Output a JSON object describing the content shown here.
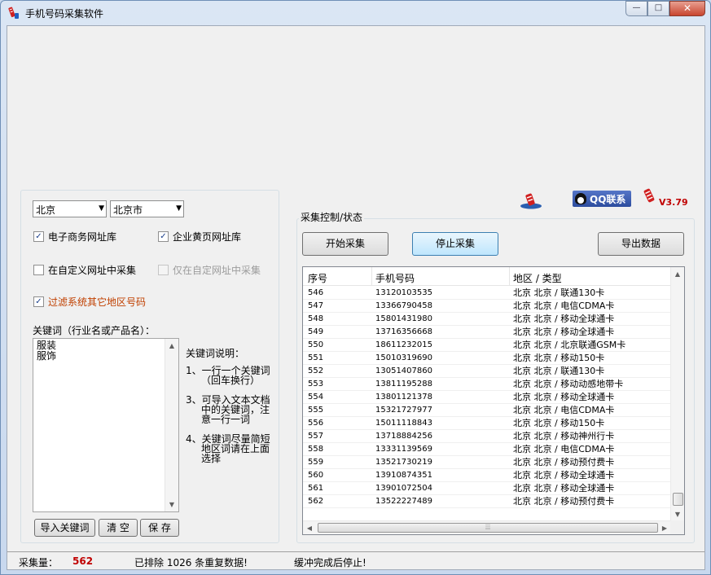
{
  "window": {
    "title": "手机号码采集软件",
    "controls": {
      "minimize": "—",
      "maximize": "□",
      "close": "✕"
    }
  },
  "left": {
    "province": "北京",
    "city": "北京市",
    "checkboxes": {
      "ecommerce": {
        "label": "电子商务网址库",
        "checked": true
      },
      "yellowpages": {
        "label": "企业黄页网址库",
        "checked": true
      },
      "custom": {
        "label": "在自定义网址中采集",
        "checked": false
      },
      "custom_only": {
        "label": "仅在自定网址中采集",
        "checked": false
      },
      "filter": {
        "label": "过滤系统其它地区号码",
        "checked": true
      }
    },
    "keyword_label": "关键词（行业名或产品名）：",
    "keywords": [
      "服装",
      "服饰"
    ],
    "help_title": "关键词说明：",
    "help": [
      [
        "1、一行一个关键词",
        "（回车换行）"
      ],
      [
        "3、可导入文本文档",
        "中的关键词，注",
        "意一行一词"
      ],
      [
        "4、关键词尽量简短",
        "地区词请在上面",
        "选择"
      ]
    ],
    "buttons": {
      "import": "导入关键词",
      "clear": "清 空",
      "save": "保 存"
    }
  },
  "header": {
    "qq": "QQ联系",
    "version": "V3.79"
  },
  "collect": {
    "title": "采集控制/状态",
    "start": "开始采集",
    "stop": "停止采集",
    "export": "导出数据",
    "columns": [
      "序号",
      "手机号码",
      "地区 / 类型"
    ],
    "rows": [
      [
        "546",
        "13120103535",
        "北京 北京 / 联通130卡"
      ],
      [
        "547",
        "13366790458",
        "北京 北京 / 电信CDMA卡"
      ],
      [
        "548",
        "15801431980",
        "北京 北京 / 移动全球通卡"
      ],
      [
        "549",
        "13716356668",
        "北京 北京 / 移动全球通卡"
      ],
      [
        "550",
        "18611232015",
        "北京 北京 / 北京联通GSM卡"
      ],
      [
        "551",
        "15010319690",
        "北京 北京 / 移动150卡"
      ],
      [
        "552",
        "13051407860",
        "北京 北京 / 联通130卡"
      ],
      [
        "553",
        "13811195288",
        "北京 北京 / 移动动感地带卡"
      ],
      [
        "554",
        "13801121378",
        "北京 北京 / 移动全球通卡"
      ],
      [
        "555",
        "15321727977",
        "北京 北京 / 电信CDMA卡"
      ],
      [
        "556",
        "15011118843",
        "北京 北京 / 移动150卡"
      ],
      [
        "557",
        "13718884256",
        "北京 北京 / 移动神州行卡"
      ],
      [
        "558",
        "13331139569",
        "北京 北京 / 电信CDMA卡"
      ],
      [
        "559",
        "13521730219",
        "北京 北京 / 移动预付费卡"
      ],
      [
        "560",
        "13910874351",
        "北京 北京 / 移动全球通卡"
      ],
      [
        "561",
        "13901072504",
        "北京 北京 / 移动全球通卡"
      ],
      [
        "562",
        "13522227489",
        "北京 北京 / 移动预付费卡"
      ]
    ]
  },
  "status": {
    "count_label": "采集量：",
    "count": "562",
    "dedup": "已排除 1026 条重复数据!",
    "buffer": "缓冲完成后停止!"
  },
  "colors": {
    "accent_red": "#c00000",
    "warn_orange": "#c04000",
    "focus_blue": "#3c7fb1"
  }
}
